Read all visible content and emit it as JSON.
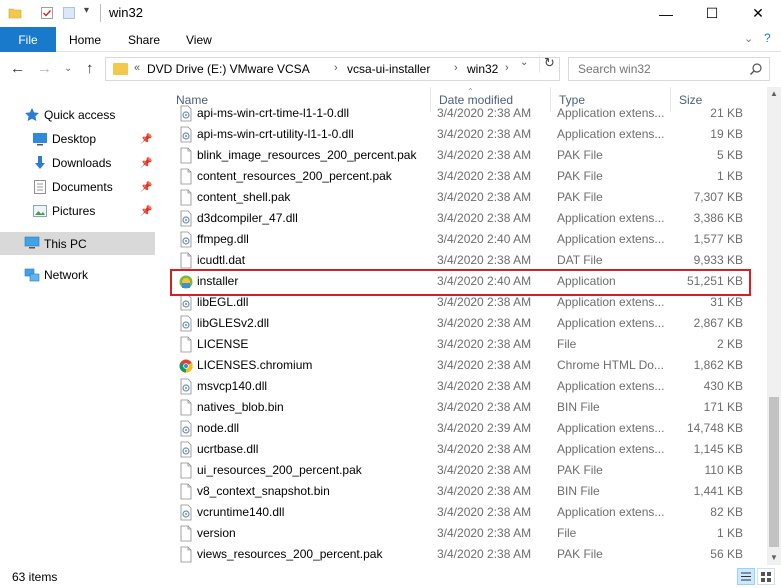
{
  "window": {
    "title": "win32",
    "minimize": "—",
    "maximize": "☐",
    "close": "✕"
  },
  "ribbon": {
    "file": "File",
    "tabs": [
      "Home",
      "Share",
      "View"
    ],
    "collapse": "⌄",
    "help": "?"
  },
  "nav": {
    "back": "←",
    "forward": "→",
    "recent": "⌄",
    "up": "↑"
  },
  "address": {
    "overflow": "«",
    "segments": [
      "DVD Drive (E:) VMware VCSA",
      "vcsa-ui-installer",
      "win32"
    ],
    "refresh": "↻"
  },
  "search": {
    "placeholder": "Search win32"
  },
  "sidebar": {
    "items": [
      {
        "label": "Quick access",
        "pinned": false
      },
      {
        "label": "Desktop",
        "pinned": true
      },
      {
        "label": "Downloads",
        "pinned": true
      },
      {
        "label": "Documents",
        "pinned": true
      },
      {
        "label": "Pictures",
        "pinned": true
      },
      {
        "label": "This PC",
        "pinned": false
      },
      {
        "label": "Network",
        "pinned": false
      }
    ]
  },
  "columns": {
    "name": "Name",
    "date": "Date modified",
    "type": "Type",
    "size": "Size"
  },
  "files": [
    {
      "name": "api-ms-win-crt-time-l1-1-0.dll",
      "date": "3/4/2020 2:38 AM",
      "type": "Application extens...",
      "size": "21 KB",
      "icon": "dll"
    },
    {
      "name": "api-ms-win-crt-utility-l1-1-0.dll",
      "date": "3/4/2020 2:38 AM",
      "type": "Application extens...",
      "size": "19 KB",
      "icon": "dll"
    },
    {
      "name": "blink_image_resources_200_percent.pak",
      "date": "3/4/2020 2:38 AM",
      "type": "PAK File",
      "size": "5 KB",
      "icon": "file"
    },
    {
      "name": "content_resources_200_percent.pak",
      "date": "3/4/2020 2:38 AM",
      "type": "PAK File",
      "size": "1 KB",
      "icon": "file"
    },
    {
      "name": "content_shell.pak",
      "date": "3/4/2020 2:38 AM",
      "type": "PAK File",
      "size": "7,307 KB",
      "icon": "file"
    },
    {
      "name": "d3dcompiler_47.dll",
      "date": "3/4/2020 2:38 AM",
      "type": "Application extens...",
      "size": "3,386 KB",
      "icon": "dll"
    },
    {
      "name": "ffmpeg.dll",
      "date": "3/4/2020 2:40 AM",
      "type": "Application extens...",
      "size": "1,577 KB",
      "icon": "dll"
    },
    {
      "name": "icudtl.dat",
      "date": "3/4/2020 2:38 AM",
      "type": "DAT File",
      "size": "9,933 KB",
      "icon": "file"
    },
    {
      "name": "installer",
      "date": "3/4/2020 2:40 AM",
      "type": "Application",
      "size": "51,251 KB",
      "icon": "app"
    },
    {
      "name": "libEGL.dll",
      "date": "3/4/2020 2:38 AM",
      "type": "Application extens...",
      "size": "31 KB",
      "icon": "dll"
    },
    {
      "name": "libGLESv2.dll",
      "date": "3/4/2020 2:38 AM",
      "type": "Application extens...",
      "size": "2,867 KB",
      "icon": "dll"
    },
    {
      "name": "LICENSE",
      "date": "3/4/2020 2:38 AM",
      "type": "File",
      "size": "2 KB",
      "icon": "file"
    },
    {
      "name": "LICENSES.chromium",
      "date": "3/4/2020 2:38 AM",
      "type": "Chrome HTML Do...",
      "size": "1,862 KB",
      "icon": "chrome"
    },
    {
      "name": "msvcp140.dll",
      "date": "3/4/2020 2:38 AM",
      "type": "Application extens...",
      "size": "430 KB",
      "icon": "dll"
    },
    {
      "name": "natives_blob.bin",
      "date": "3/4/2020 2:38 AM",
      "type": "BIN File",
      "size": "171 KB",
      "icon": "file"
    },
    {
      "name": "node.dll",
      "date": "3/4/2020 2:39 AM",
      "type": "Application extens...",
      "size": "14,748 KB",
      "icon": "dll"
    },
    {
      "name": "ucrtbase.dll",
      "date": "3/4/2020 2:38 AM",
      "type": "Application extens...",
      "size": "1,145 KB",
      "icon": "dll"
    },
    {
      "name": "ui_resources_200_percent.pak",
      "date": "3/4/2020 2:38 AM",
      "type": "PAK File",
      "size": "110 KB",
      "icon": "file"
    },
    {
      "name": "v8_context_snapshot.bin",
      "date": "3/4/2020 2:38 AM",
      "type": "BIN File",
      "size": "1,441 KB",
      "icon": "file"
    },
    {
      "name": "vcruntime140.dll",
      "date": "3/4/2020 2:38 AM",
      "type": "Application extens...",
      "size": "82 KB",
      "icon": "dll"
    },
    {
      "name": "version",
      "date": "3/4/2020 2:38 AM",
      "type": "File",
      "size": "1 KB",
      "icon": "file"
    },
    {
      "name": "views_resources_200_percent.pak",
      "date": "3/4/2020 2:38 AM",
      "type": "PAK File",
      "size": "56 KB",
      "icon": "file"
    }
  ],
  "highlighted_file": "installer",
  "status": {
    "count": "63 items"
  },
  "colors": {
    "file_tab": "#1979ca",
    "highlight_border": "#d61f26",
    "selected_nav": "#d9d9d9",
    "header_text": "#4c607a",
    "folder": "#f2c94c"
  }
}
